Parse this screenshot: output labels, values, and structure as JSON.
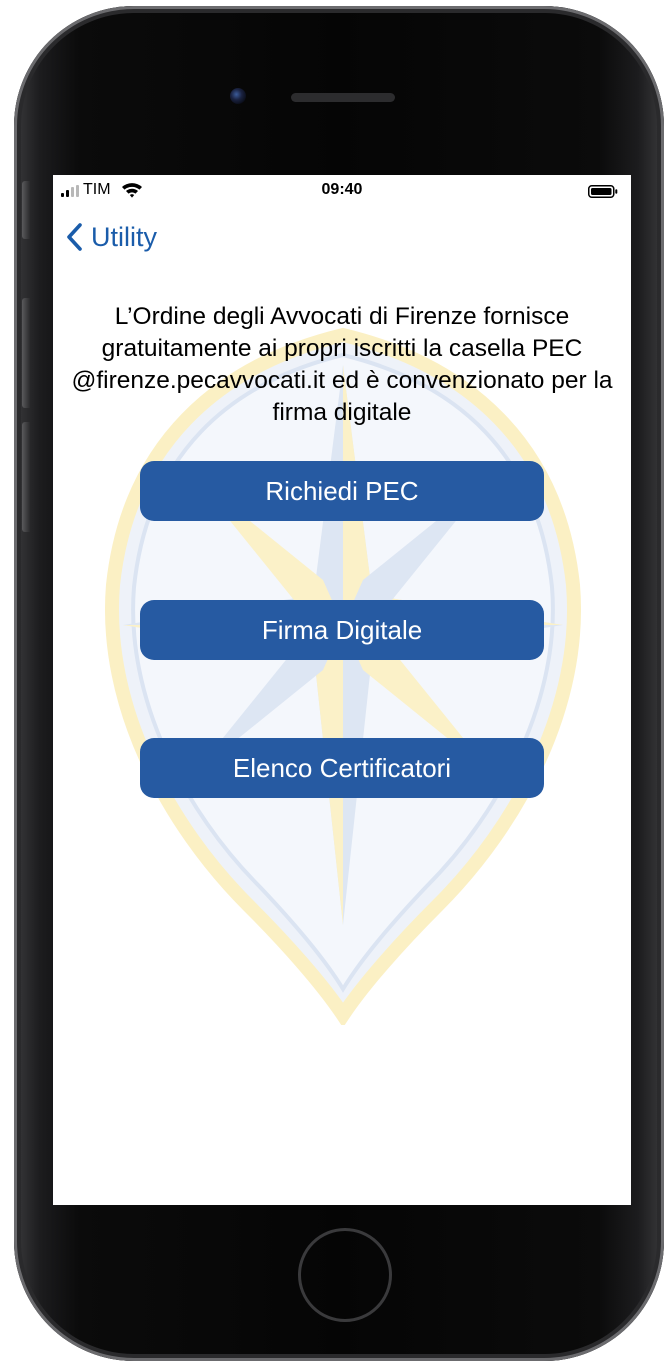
{
  "status_bar": {
    "carrier": "TIM",
    "time": "09:40"
  },
  "nav": {
    "back_label": "Utility"
  },
  "main": {
    "description": "L’Ordine degli Avvocati di Firenze fornisce gratuitamente ai propri iscritti la casella PEC @firenze.pecavvocati.it ed è convenzionato per la firma digitale",
    "buttons": [
      {
        "label": "Richiedi PEC"
      },
      {
        "label": "Firma Digitale"
      },
      {
        "label": "Elenco Certificatori"
      }
    ]
  },
  "colors": {
    "accent": "#1a5caa",
    "button": "#265aa2",
    "crest_blue": "#dbe4f2",
    "crest_gold": "#fbf0c4"
  },
  "icons": [
    "signal-icon",
    "wifi-icon",
    "battery-icon",
    "chevron-left-icon",
    "crest-watermark"
  ]
}
